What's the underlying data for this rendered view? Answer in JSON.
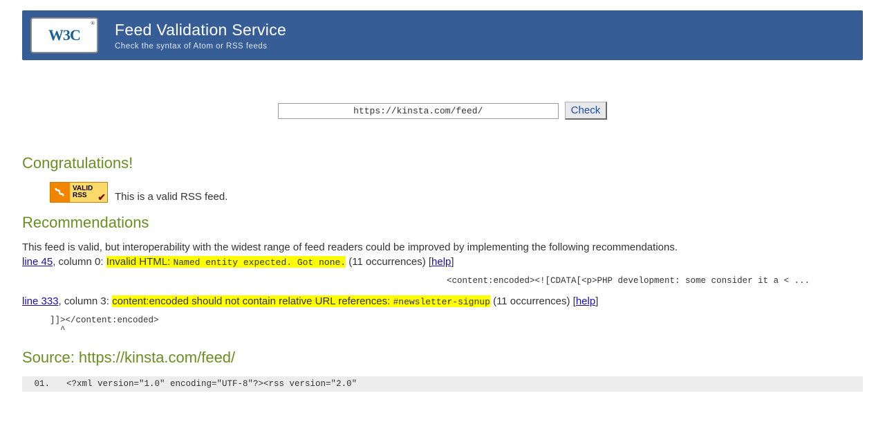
{
  "logo": {
    "text": "W3C",
    "reg": "®"
  },
  "banner": {
    "title": "Feed Validation Service",
    "subtitle": "Check the syntax of Atom or RSS feeds"
  },
  "form": {
    "url": "https://kinsta.com/feed/",
    "button": "Check"
  },
  "congrats": {
    "heading": "Congratulations!",
    "badge_top": "VALID",
    "badge_bottom": "RSS",
    "note": "This is a valid RSS feed."
  },
  "recs": {
    "heading": "Recommendations",
    "intro": "This feed is valid, but interoperability with the widest range of feed readers could be improved by implementing the following recommendations.",
    "issues": [
      {
        "line_link": "line 45",
        "col": ", column 0: ",
        "msg_html": "Invalid HTML: ",
        "msg_code": "Named entity expected. Got none.",
        "count": " (11 occurrences) [",
        "help": "help",
        "close": "]",
        "snippet": "<content:encoded><![CDATA[<p>PHP development: some consider it a < ...",
        "indent": "indent1"
      },
      {
        "line_link": "line 333",
        "col": ", column 3: ",
        "msg_html": "content:encoded should not contain relative URL references: ",
        "msg_code": "#newsletter-signup",
        "count": " (11 occurrences) [",
        "help": "help",
        "close": "]",
        "snippet": "]]></content:encoded>\n  ^",
        "indent": "indent2"
      }
    ]
  },
  "source": {
    "heading": "Source: https://kinsta.com/feed/",
    "rows": [
      {
        "n": "01.",
        "code": "<?xml version=\"1.0\" encoding=\"UTF-8\"?><rss version=\"2.0\""
      }
    ]
  }
}
